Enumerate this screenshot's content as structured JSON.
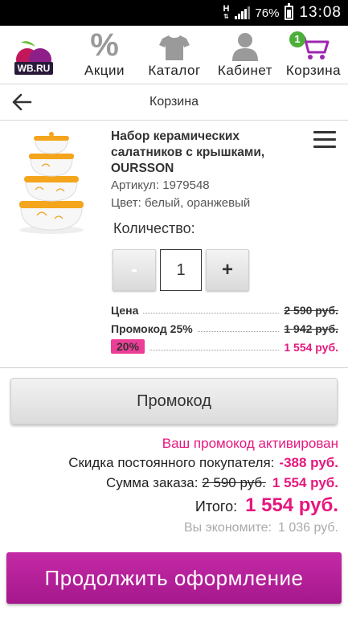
{
  "status_bar": {
    "network": "H",
    "battery": "76%",
    "time": "13:08"
  },
  "nav": {
    "logo_text": "WB.RU",
    "items": [
      {
        "label": "Акции",
        "icon": "percent-icon"
      },
      {
        "label": "Каталог",
        "icon": "tshirt-icon"
      },
      {
        "label": "Кабинет",
        "icon": "person-icon"
      },
      {
        "label": "Корзина",
        "icon": "cart-icon",
        "badge": "1"
      }
    ]
  },
  "header": {
    "title": "Корзина",
    "back_icon": "back-arrow-icon"
  },
  "product": {
    "name": "Набор керамических салатников с крышками, OURSSON",
    "article": "Артикул: 1979548",
    "color": "Цвет: белый, оранжевый",
    "quantity_label": "Количество:",
    "quantity_value": "1",
    "minus_label": "-",
    "plus_label": "+",
    "prices": {
      "price_label": "Цена",
      "price_value": "2 590 руб.",
      "promo_label": "Промокод 25%",
      "promo_value": "1 942 руб.",
      "discount_badge": "20%",
      "final_value": "1 554 руб."
    }
  },
  "promo_button_label": "Промокод",
  "summary": {
    "promo_activated": "Ваш промокод активирован",
    "discount_label": "Скидка постоянного покупателя:",
    "discount_value": "-388 руб.",
    "order_sum_label": "Сумма заказа:",
    "order_sum_old": "2 590 руб.",
    "order_sum_new": "1 554 руб.",
    "total_label": "Итого:",
    "total_value": "1 554 руб.",
    "economy_label": "Вы экономите:",
    "economy_value": "1 036 руб."
  },
  "continue_button_label": "Продолжить оформление",
  "colors": {
    "accent_pink": "#e5177e",
    "button_purple": "#b3209a",
    "badge_green": "#4caf3a",
    "logo_purple": "#8e1f8a"
  }
}
